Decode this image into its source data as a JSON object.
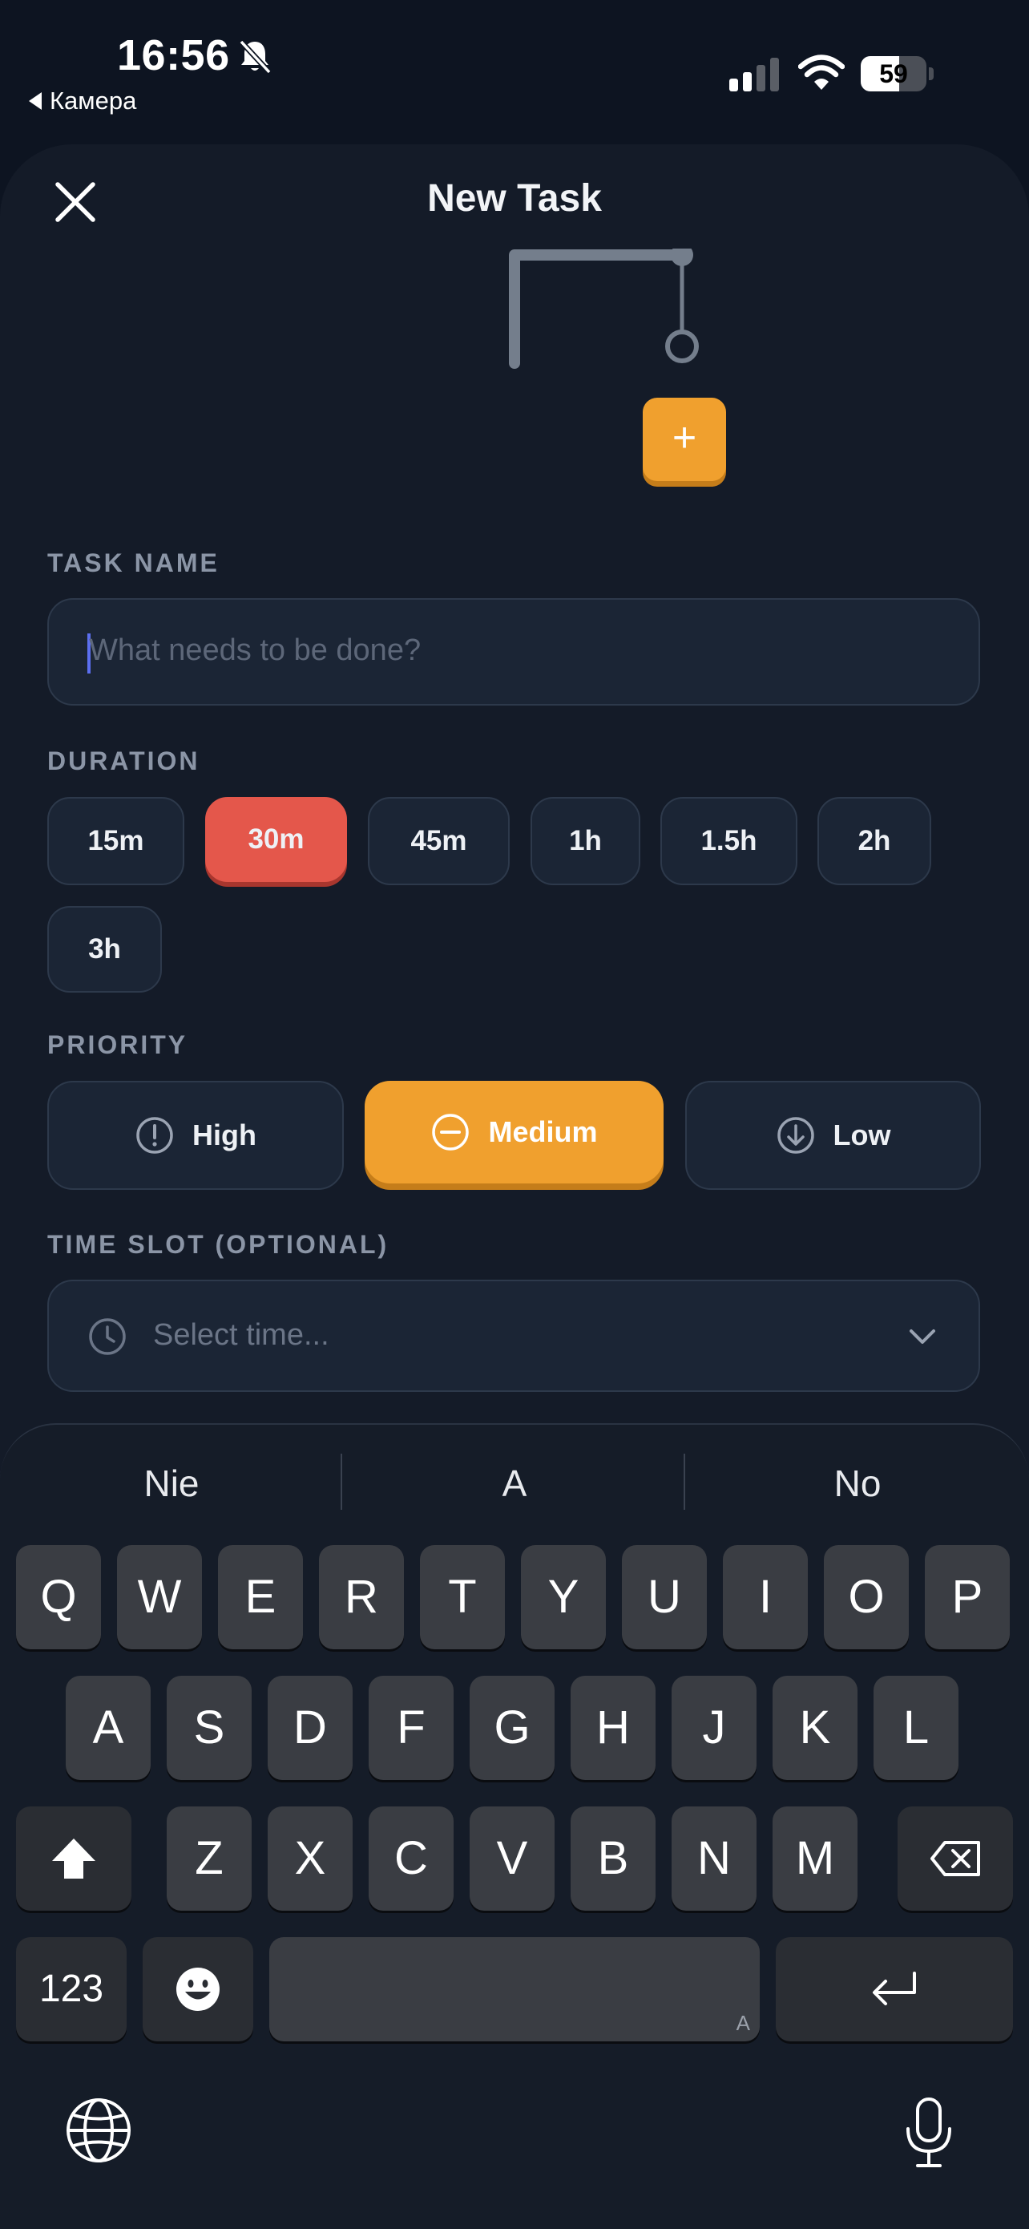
{
  "status_bar": {
    "time": "16:56",
    "back_label": "Камера",
    "battery": "59",
    "battery_level": 0.59
  },
  "header": {
    "title": "New Task"
  },
  "task_name": {
    "label": "TASK NAME",
    "placeholder": "What needs to be done?"
  },
  "duration": {
    "label": "DURATION",
    "options": [
      "15m",
      "30m",
      "45m",
      "1h",
      "1.5h",
      "2h",
      "3h"
    ],
    "selected": "30m"
  },
  "priority": {
    "label": "PRIORITY",
    "options": [
      "High",
      "Medium",
      "Low"
    ],
    "selected": "Medium"
  },
  "time_slot": {
    "label": "TIME SLOT (OPTIONAL)",
    "placeholder": "Select time..."
  },
  "keyboard": {
    "suggestions": [
      "Nie",
      "A",
      "No"
    ],
    "row1": [
      "Q",
      "W",
      "E",
      "R",
      "T",
      "Y",
      "U",
      "I",
      "O",
      "P"
    ],
    "row2": [
      "A",
      "S",
      "D",
      "F",
      "G",
      "H",
      "J",
      "K",
      "L"
    ],
    "row3": [
      "Z",
      "X",
      "C",
      "V",
      "B",
      "N",
      "M"
    ],
    "numbers_key": "123",
    "space_mark": "A"
  },
  "colors": {
    "background": "#0d1421",
    "sheet": "#141b28",
    "accent_red": "#e4574b",
    "accent_orange": "#f0a02e",
    "field": "#1b2535"
  },
  "icons": {
    "close": "close-icon",
    "add": "plus-icon",
    "high": "exclamation-circle-icon",
    "medium": "minus-circle-icon",
    "low": "arrow-down-circle-icon",
    "time": "clock-icon",
    "select": "chevron-down-icon",
    "shift": "shift-icon",
    "delete": "backspace-icon",
    "emoji": "emoji-icon",
    "return": "return-icon",
    "globe": "globe-icon",
    "mic": "microphone-icon"
  }
}
